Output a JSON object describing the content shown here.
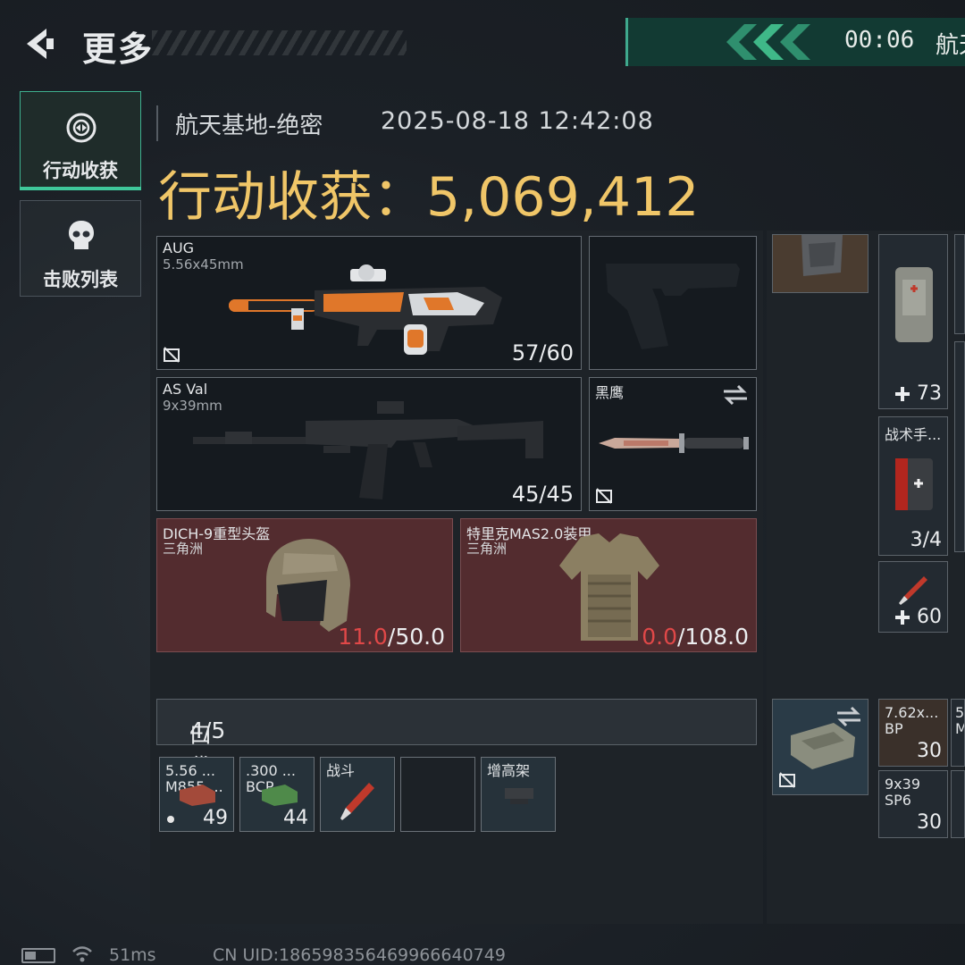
{
  "header": {
    "title": "更多",
    "timer": "00:06",
    "timer_label": "航天"
  },
  "tabs": [
    {
      "label": "行动收获",
      "active": true
    },
    {
      "label": "击败列表",
      "active": false
    }
  ],
  "info": {
    "map": "航天基地-绝密",
    "datetime": "2025-08-18 12:42:08",
    "loot_label": "行动收获：",
    "loot_value": "5,069,412"
  },
  "weapons": [
    {
      "name": "AUG",
      "caliber": "5.56x45mm",
      "ammo": "57/60"
    },
    {
      "name": "AS Val",
      "caliber": "9x39mm",
      "ammo": "45/45"
    }
  ],
  "knife": {
    "name": "黑鹰"
  },
  "armor": [
    {
      "name": "DICH-9重型头盔",
      "maker": "三角洲",
      "durability_current": "11.0",
      "durability_max": "/50.0"
    },
    {
      "name": "特里克MAS2.0装甲",
      "maker": "三角洲",
      "durability_current": "0.0",
      "durability_max": "/108.0"
    }
  ],
  "pocket": {
    "label": "口袋：",
    "capacity": "4/5",
    "items": [
      {
        "line1": "5.56 ...",
        "line2": "M855 ...",
        "count": "49"
      },
      {
        "line1": ".300 ...",
        "line2": "BCP ...",
        "count": "44"
      },
      {
        "line1": "战斗",
        "line2": "",
        "count": ""
      },
      {
        "line1": "",
        "line2": "",
        "count": ""
      },
      {
        "line1": "增高架",
        "line2": "",
        "count": ""
      }
    ]
  },
  "right_items": {
    "med1_count": "73",
    "med2_name": "战术手...",
    "med2_count": "3/4",
    "syringe_count": "60",
    "ammo1_line1": "7.62x...",
    "ammo1_line2": "BP",
    "ammo1_count": "30",
    "ammo2_line1": "9x39",
    "ammo2_line2": "SP6",
    "ammo2_count": "30",
    "ammo3_line1": "5",
    "ammo3_line2": "M"
  },
  "footer": {
    "ping": "51ms",
    "uid": "CN UID:18659835646996664​0749"
  },
  "colors": {
    "accent": "#3fc79a",
    "loot_gold": "#f0c668",
    "armor_bg": "#532c2f",
    "durability_red": "#e04848"
  }
}
